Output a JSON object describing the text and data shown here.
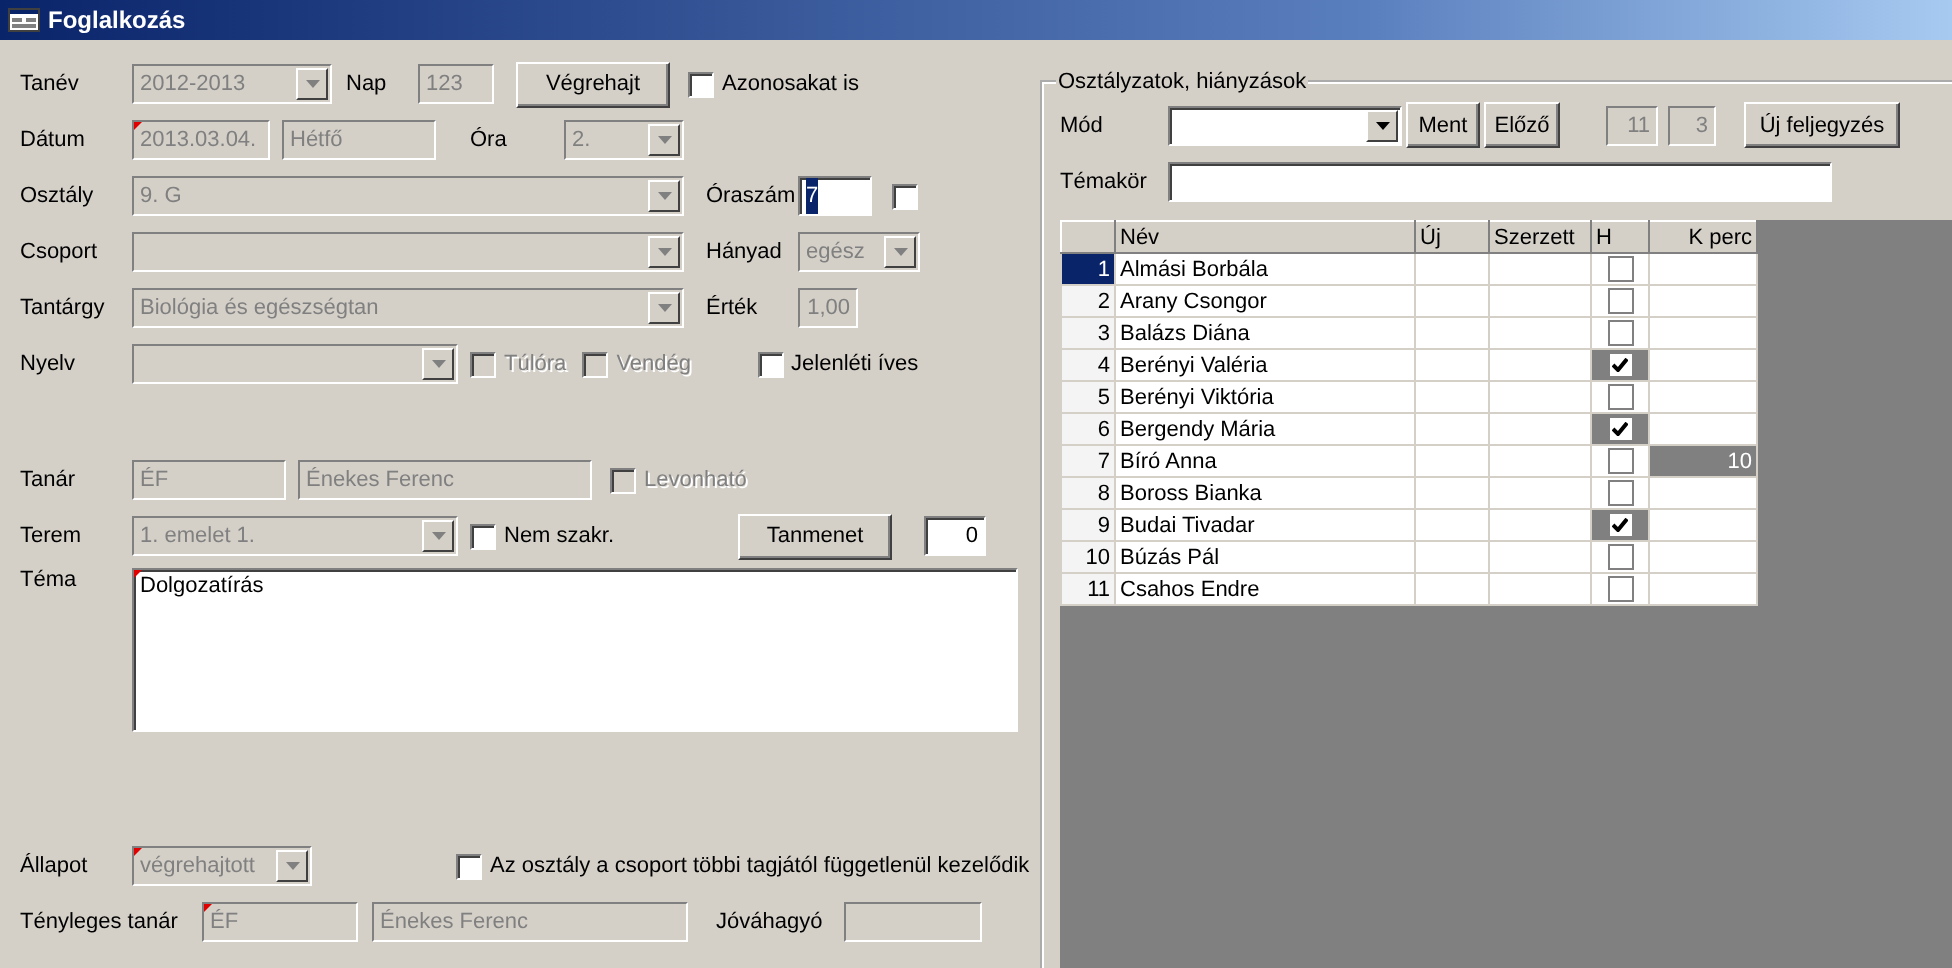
{
  "window": {
    "title": "Foglalkozás"
  },
  "form": {
    "tanev": {
      "label": "Tanév",
      "value": "2012-2013",
      "disabled": true
    },
    "nap": {
      "label": "Nap",
      "value": "123",
      "disabled": true
    },
    "vegrehajt": {
      "label": "Végrehajt"
    },
    "azonosakat": {
      "label": "Azonosakat is",
      "checked": false,
      "disabled": false
    },
    "datum": {
      "label": "Dátum",
      "value": "2013.03.04.",
      "disabled": true,
      "required": true
    },
    "nap_neve": {
      "value": "Hétfő",
      "disabled": true
    },
    "ora": {
      "label": "Óra",
      "value": "2.",
      "disabled": true
    },
    "osztaly": {
      "label": "Osztály",
      "value": "9. G",
      "disabled": true
    },
    "oraszam": {
      "label": "Óraszám",
      "value": "7",
      "disabled": false,
      "text_selected": true
    },
    "oraszam_check": {
      "checked": false,
      "disabled": false
    },
    "csoport": {
      "label": "Csoport",
      "disabled": true
    },
    "hanyad": {
      "label": "Hányad",
      "value": "egész",
      "disabled": true
    },
    "tantargy": {
      "label": "Tantárgy",
      "value": "Biológia és egészségtan",
      "disabled": true
    },
    "ertek": {
      "label": "Érték",
      "value": "1,00",
      "disabled": true
    },
    "nyelv": {
      "label": "Nyelv",
      "disabled": true
    },
    "tulora": {
      "label": "Túlóra",
      "checked": false,
      "disabled": true
    },
    "vendeg": {
      "label": "Vendég",
      "checked": false,
      "disabled": true
    },
    "jelenleti": {
      "label": "Jelenléti íves",
      "checked": false,
      "disabled": false
    },
    "tanar": {
      "label": "Tanár",
      "value": "ÉF",
      "disabled": true
    },
    "tanar_nev": {
      "value": "Énekes Ferenc",
      "disabled": true
    },
    "levonhato": {
      "label": "Levonható",
      "checked": false,
      "disabled": true
    },
    "terem": {
      "label": "Terem",
      "value": "1. emelet 1.",
      "disabled": true
    },
    "nem_szakr": {
      "label": "Nem szakr.",
      "checked": false,
      "disabled": false
    },
    "tanmenet": {
      "label": "Tanmenet"
    },
    "tanmenet_szam": {
      "value": "0",
      "disabled": false
    },
    "tema": {
      "label": "Téma",
      "value": "Dolgozatírás",
      "disabled": false,
      "required": true
    },
    "allapot": {
      "label": "Állapot",
      "value": "végrehajtott",
      "disabled": true,
      "required": true
    },
    "fuggetlen": {
      "label": "Az osztály a csoport többi tagjától függetlenül kezelődik",
      "checked": false,
      "disabled": false
    },
    "tenyleges_tanar": {
      "label": "Tényleges tanár",
      "value": "ÉF",
      "disabled": true,
      "required": true
    },
    "tenyleges_nev": {
      "value": "Énekes Ferenc",
      "disabled": true
    },
    "jovahagyo": {
      "label": "Jóváhagyó",
      "disabled": true
    }
  },
  "grades": {
    "title": "Osztályzatok, hiányzások",
    "mod": {
      "label": "Mód",
      "disabled": false
    },
    "ment": {
      "label": "Ment"
    },
    "elozo": {
      "label": "Előző"
    },
    "count_1": {
      "value": "11",
      "disabled": true
    },
    "count_2": {
      "value": "3",
      "disabled": true
    },
    "uj_feljegyzes": {
      "label": "Új feljegyzés"
    },
    "temakor": {
      "label": "Témakör",
      "disabled": false
    },
    "table": {
      "columns": [
        "Név",
        "Új",
        "Szerzett",
        "H",
        "K perc"
      ],
      "rows": [
        {
          "number": "1",
          "name": "Almási Borbála",
          "absent": false,
          "selected": true
        },
        {
          "number": "2",
          "name": "Arany Csongor",
          "absent": false,
          "selected": false
        },
        {
          "number": "3",
          "name": "Balázs Diána",
          "absent": false,
          "selected": false
        },
        {
          "number": "4",
          "name": "Berényi Valéria",
          "absent": true,
          "selected": false
        },
        {
          "number": "5",
          "name": "Berényi Viktória",
          "absent": false,
          "selected": false
        },
        {
          "number": "6",
          "name": "Bergendy Mária",
          "absent": true,
          "selected": false
        },
        {
          "number": "7",
          "name": "Bíró Anna",
          "absent": false,
          "selected": false,
          "k_perc": "10"
        },
        {
          "number": "8",
          "name": "Boross Bianka",
          "absent": false,
          "selected": false
        },
        {
          "number": "9",
          "name": "Budai Tivadar",
          "absent": true,
          "selected": false
        },
        {
          "number": "10",
          "name": "Búzás Pál",
          "absent": false,
          "selected": false
        },
        {
          "number": "11",
          "name": "Csahos Endre",
          "absent": false,
          "selected": false
        }
      ]
    }
  }
}
